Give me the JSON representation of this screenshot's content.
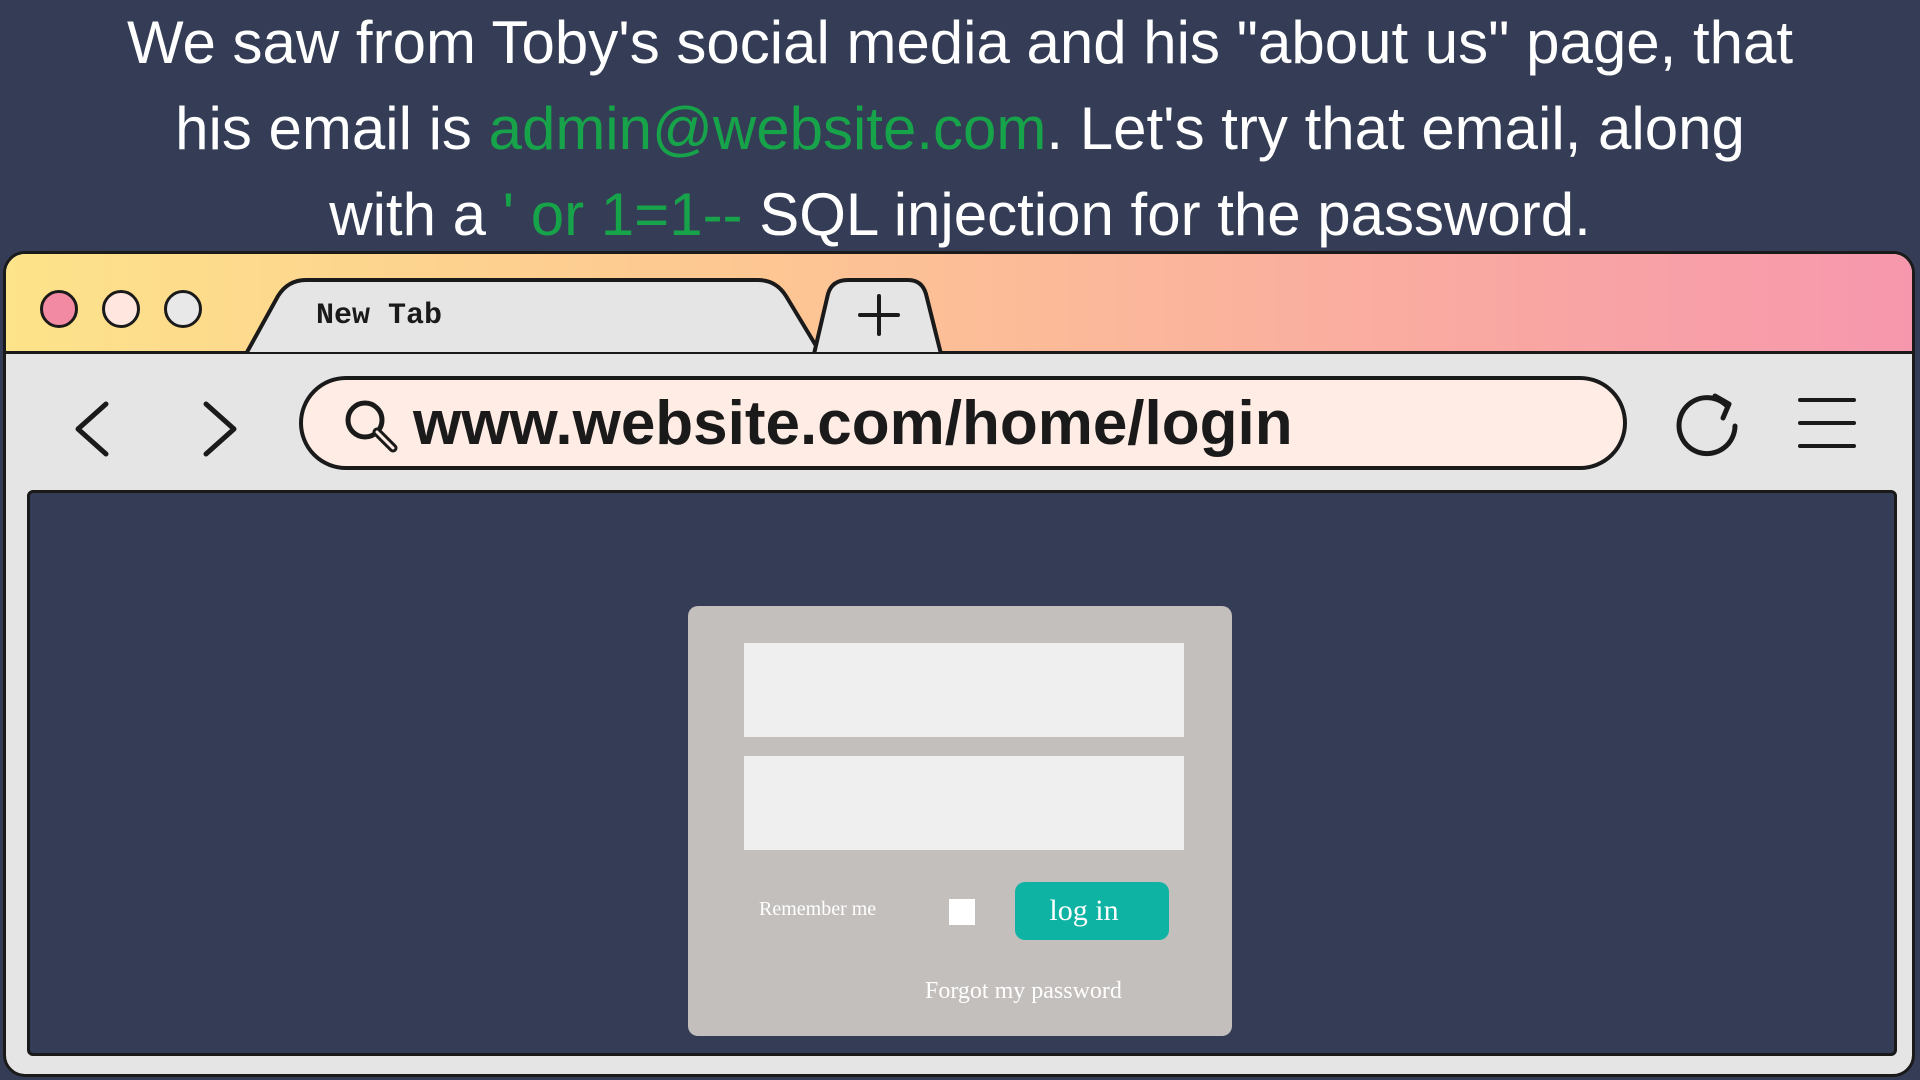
{
  "caption": {
    "line1": "We saw from Toby's social media and his \"about us\" page, that",
    "line2_before": "his email is ",
    "line2_email": "admin@website.com",
    "line2_after": ". Let's try that email, along",
    "line3_before": "with a ",
    "line3_injection": "' or 1=1--",
    "line3_after": " SQL injection for the password.",
    "highlight_color": "#17a34a"
  },
  "browser": {
    "tab_title": "New Tab",
    "new_tab_icon": "plus-icon",
    "url": "www.website.com/home/login",
    "icons": {
      "back": "chevron-left-icon",
      "forward": "chevron-right-icon",
      "search": "search-icon",
      "reload": "reload-icon",
      "menu": "hamburger-menu-icon"
    },
    "window_controls": {
      "close_color": "#f38aa4",
      "minimize_color": "#ffe7df",
      "maximize_color": "#e8e8e8"
    }
  },
  "login": {
    "email_value": "",
    "password_value": "",
    "remember_label": "Remember me",
    "remember_checked": false,
    "login_label": "log in",
    "forgot_label": "Forgot my password",
    "button_color": "#0fb3a3"
  }
}
